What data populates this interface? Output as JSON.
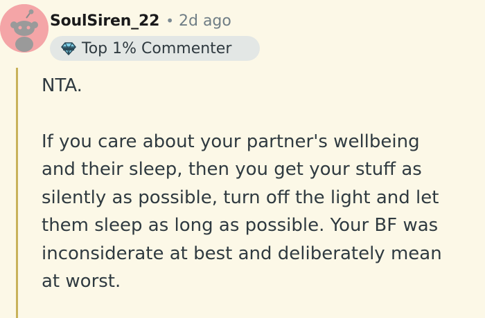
{
  "comment": {
    "username": "SoulSiren_22",
    "separator": "•",
    "timestamp": "2d ago",
    "badge": {
      "label": "Top 1% Commenter",
      "icon": "top-commenter-icon"
    },
    "avatar": {
      "icon": "snoo-avatar-icon",
      "background": "#f4a5a7"
    },
    "body": {
      "paragraph1": "NTA.",
      "paragraph2_lines": [
        "If you care about your partner's wellbeing",
        "and their sleep, then you get your stuff as",
        "silently as possible, turn off the light and let",
        "them sleep as long as possible. Your BF was",
        "inconsiderate at best and deliberately mean",
        "at worst."
      ]
    }
  },
  "colors": {
    "page_background": "#fcf8e7",
    "thread_line": "#c8b25a",
    "badge_background": "#e3e7e5"
  }
}
